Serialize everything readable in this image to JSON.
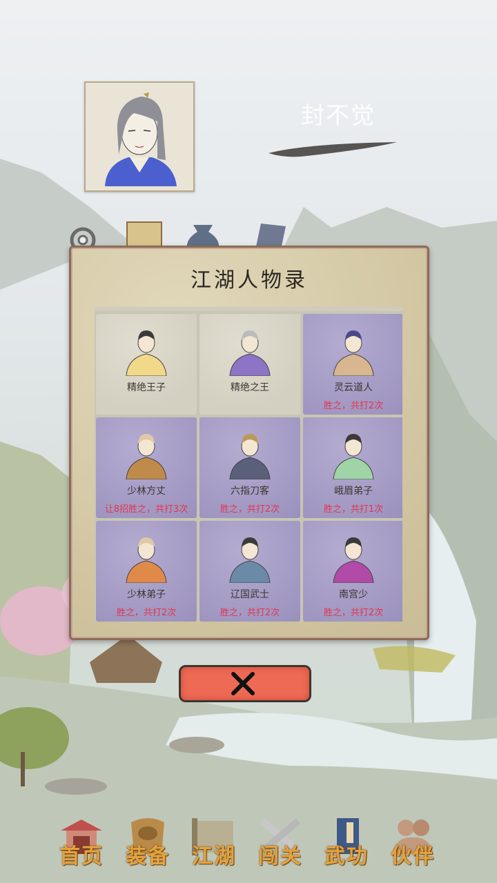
{
  "header": {
    "player_name": "封不觉",
    "avatar": "portrait-icon"
  },
  "top_icons": [
    "gear-icon",
    "scroll-icon",
    "pouch-icon",
    "tablet-icon"
  ],
  "dialog": {
    "title": "江湖人物录",
    "close_icon": "close-x-icon",
    "characters": [
      {
        "name": "精绝王子",
        "record": "",
        "defeated": false
      },
      {
        "name": "精绝之王",
        "record": "",
        "defeated": false
      },
      {
        "name": "灵云道人",
        "record": "胜之，共打2次",
        "defeated": true
      },
      {
        "name": "少林方丈",
        "record": "让8招胜之，共打3次",
        "defeated": true
      },
      {
        "name": "六指刀客",
        "record": "胜之，共打2次",
        "defeated": true
      },
      {
        "name": "峨眉弟子",
        "record": "胜之，共打1次",
        "defeated": true
      },
      {
        "name": "少林弟子",
        "record": "胜之，共打2次",
        "defeated": true
      },
      {
        "name": "辽国武士",
        "record": "胜之，共打2次",
        "defeated": true
      },
      {
        "name": "南宫少",
        "record": "胜之，共打2次",
        "defeated": true
      }
    ]
  },
  "nav": [
    {
      "label": "首页",
      "icon": "house-icon"
    },
    {
      "label": "装备",
      "icon": "armor-icon"
    },
    {
      "label": "江湖",
      "icon": "map-scroll-icon"
    },
    {
      "label": "闯关",
      "icon": "crossed-swords-icon"
    },
    {
      "label": "武功",
      "icon": "book-icon"
    },
    {
      "label": "伙伴",
      "icon": "companions-icon"
    }
  ],
  "colors": {
    "defeated_cell": "#a89fc7",
    "record_text": "#e5334e",
    "nav_label": "#e6a23c",
    "close_button": "#ee6a55"
  }
}
